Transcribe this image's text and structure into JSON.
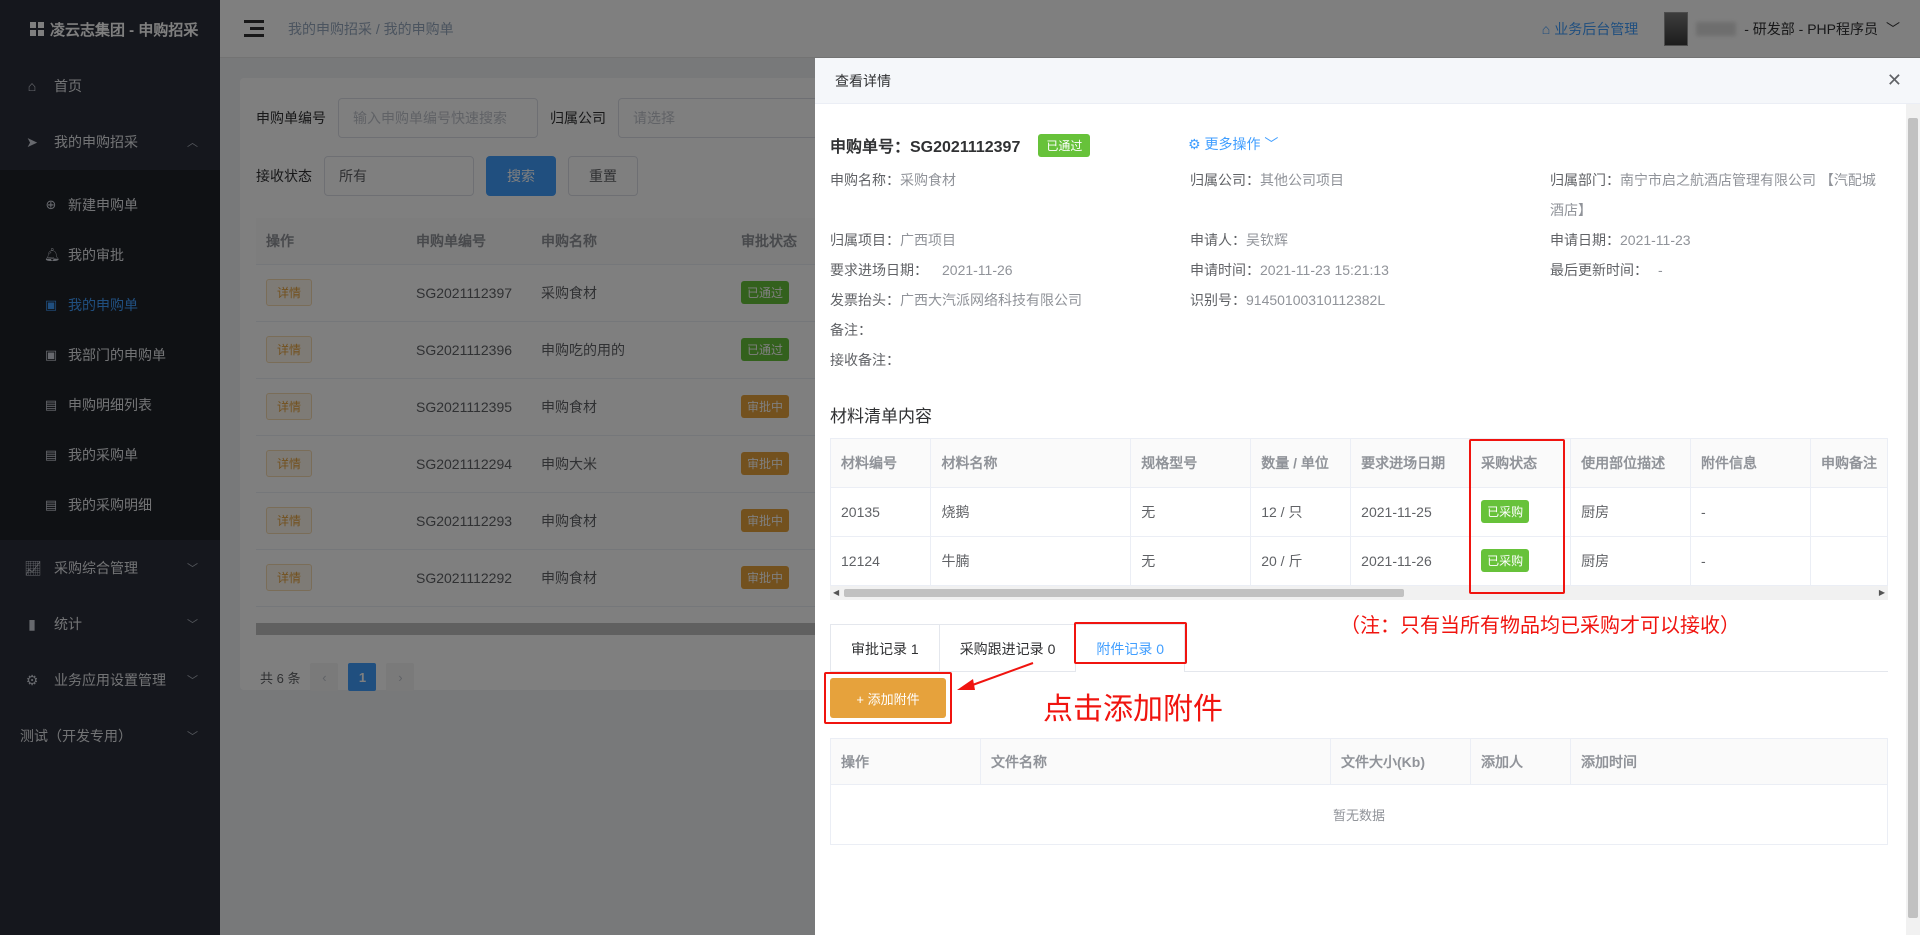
{
  "brand": "凌云志集团 - 申购招采",
  "sidebar": {
    "home": "首页",
    "my_purchase": "我的申购招采",
    "sub": [
      "新建申购单",
      "我的审批",
      "我的申购单",
      "我部门的申购单",
      "申购明细列表",
      "我的采购单",
      "我的采购明细"
    ],
    "purchase_mgmt": "采购综合管理",
    "stats": "统计",
    "app_settings": "业务应用设置管理",
    "test": "测试（开发专用）"
  },
  "header": {
    "breadcrumb": "我的申购招采 / 我的申购单",
    "backend": "业务后台管理",
    "user_role": "- 研发部 - PHP程序员"
  },
  "filter": {
    "no_label": "申购单编号",
    "no_placeholder": "输入申购单编号快速搜索",
    "company_label": "归属公司",
    "company_placeholder": "请选择",
    "status_label": "接收状态",
    "status_value": "所有",
    "search": "搜索",
    "reset": "重置"
  },
  "list_table": {
    "headers": [
      "操作",
      "申购单编号",
      "申购名称",
      "审批状态"
    ],
    "detail": "详情",
    "rows": [
      {
        "no": "SG2021112397",
        "name": "采购食材",
        "status": "已通过"
      },
      {
        "no": "SG2021112396",
        "name": "申购吃的用的",
        "status": "已通过"
      },
      {
        "no": "SG2021112395",
        "name": "申购食材",
        "status": "审批中"
      },
      {
        "no": "SG2021112294",
        "name": "申购大米",
        "status": "审批中"
      },
      {
        "no": "SG2021112293",
        "name": "申购食材",
        "status": "审批中"
      },
      {
        "no": "SG2021112292",
        "name": "申购食材",
        "status": "审批中"
      }
    ]
  },
  "pager": {
    "total": "共 6 条",
    "page": "1"
  },
  "drawer": {
    "title": "查看详情",
    "order_no": "申购单号：SG2021112397",
    "status": "已通过",
    "more_ops": "更多操作",
    "info": {
      "name_l": "申购名称：",
      "name_v": "采购食材",
      "company_l": "归属公司：",
      "company_v": "其他公司项目",
      "dept_l": "归属部门：",
      "dept_v1": "南宁市启之航酒店管理有限公司 【汽配城",
      "dept_v2": "酒店】",
      "project_l": "归属项目：",
      "project_v": "广西项目",
      "applicant_l": "申请人：",
      "applicant_v": "吴钦辉",
      "date_l": "申请日期：",
      "date_v": "2021-11-23",
      "req_date_l": "要求进场日期：",
      "req_date_v": "2021-11-26",
      "time_l": "申请时间：",
      "time_v": "2021-11-23 15:21:13",
      "updated_l": "最后更新时间：",
      "updated_v": "-",
      "invoice_l": "发票抬头：",
      "invoice_v": "广西大汽派网络科技有限公司",
      "taxid_l": "识别号：",
      "taxid_v": "91450100310112382L",
      "remark_l": "备注：",
      "recv_remark_l": "接收备注："
    },
    "materials_title": "材料清单内容",
    "materials": {
      "headers": [
        "材料编号",
        "材料名称",
        "规格型号",
        "数量 / 单位",
        "要求进场日期",
        "采购状态",
        "使用部位描述",
        "附件信息",
        "申购备注"
      ],
      "rows": [
        {
          "code": "20135",
          "name": "烧鹅",
          "spec": "无",
          "qty": "12 / 只",
          "date": "2021-11-25",
          "status": "已采购",
          "part": "厨房",
          "att": "-"
        },
        {
          "code": "12124",
          "name": "牛腩",
          "spec": "无",
          "qty": "20 / 斤",
          "date": "2021-11-26",
          "status": "已采购",
          "part": "厨房",
          "att": "-"
        }
      ]
    },
    "tabs": [
      "审批记录 1",
      "采购跟进记录 0",
      "附件记录 0"
    ],
    "add_attachment": "+ 添加附件",
    "attach_headers": [
      "操作",
      "文件名称",
      "文件大小(Kb)",
      "添加人",
      "添加时间"
    ],
    "empty": "暂无数据"
  },
  "annotations": {
    "note": "（注：只有当所有物品均已采购才可以接收）",
    "click_hint": "点击添加附件"
  }
}
